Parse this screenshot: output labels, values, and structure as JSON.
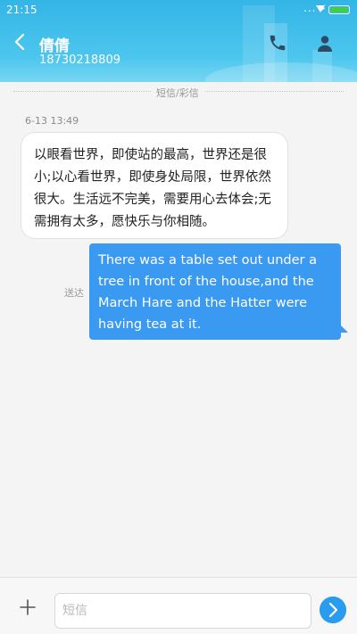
{
  "status_bar": {
    "time": "21:15",
    "signal_dots": "...",
    "battery_color": "#3ccf4e"
  },
  "header": {
    "contact_name": "倩倩",
    "phone_number": "18730218809",
    "back_icon": "chevron-left-icon",
    "call_icon": "phone-icon",
    "profile_icon": "person-icon",
    "gradient_color": "#33b5e6"
  },
  "conversation": {
    "divider_label": "短信/彩信",
    "messages": [
      {
        "direction": "incoming",
        "timestamp": "6-13 13:49",
        "text": "以眼看世界，即使站的最高，世界还是很小;以心看世界，即使身处局限，世界依然很大。生活远不完美，需要用心去体会;无需拥有太多，愿快乐与你相随。"
      },
      {
        "direction": "outgoing",
        "status": "送达",
        "text": "There was a table set out under a tree in front of the house,and the March Hare and the Hatter were having tea at it.",
        "bubble_color": "#3a9af2"
      }
    ]
  },
  "composer": {
    "placeholder": "短信",
    "value": "",
    "add_icon": "plus-icon",
    "send_icon": "send-arrow-icon",
    "send_color": "#2a9cf0"
  }
}
